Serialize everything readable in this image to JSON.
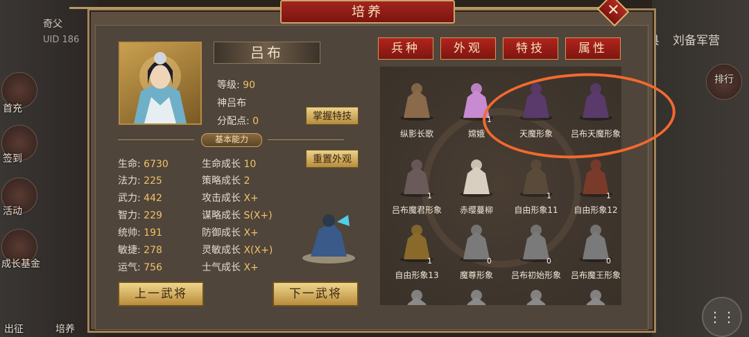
{
  "title": "培养",
  "close_icon": "close-icon",
  "background": {
    "player_name": "奇父",
    "uid": "UID 186",
    "right_tabs": [
      "县",
      "刘备军营"
    ],
    "left_side_buttons": [
      "首充",
      "签到",
      "活动",
      "成长基金"
    ],
    "bottom_left_buttons": [
      "出征",
      "培养"
    ],
    "right_side_buttons": [
      "排行"
    ],
    "bottom_right_icon": "more-icon"
  },
  "hero": {
    "name": "吕布",
    "level_label": "等级:",
    "level": "90",
    "title": "神吕布",
    "points_label": "分配点:",
    "points": "0"
  },
  "buttons": {
    "master_skill": "掌握特技",
    "reset_look": "重置外观",
    "prev": "上一武将",
    "next": "下一武将"
  },
  "section_title": "基本能力",
  "stats_left": [
    {
      "label": "生命:",
      "value": "6730"
    },
    {
      "label": "法力:",
      "value": "225"
    },
    {
      "label": "武力:",
      "value": "442"
    },
    {
      "label": "智力:",
      "value": "229"
    },
    {
      "label": "统帅:",
      "value": "191"
    },
    {
      "label": "敏捷:",
      "value": "278"
    },
    {
      "label": "运气:",
      "value": "756"
    }
  ],
  "stats_right": [
    {
      "label": "生命成长",
      "value": "10"
    },
    {
      "label": "策略成长",
      "value": "2"
    },
    {
      "label": "攻击成长",
      "value": "X+"
    },
    {
      "label": "谋略成长",
      "value": "S(X+)"
    },
    {
      "label": "防御成长",
      "value": "X+"
    },
    {
      "label": "灵敏成长",
      "value": "X(X+)"
    },
    {
      "label": "士气成长",
      "value": "X+"
    }
  ],
  "tabs": [
    "兵种",
    "外观",
    "特技",
    "属性"
  ],
  "skins": [
    {
      "label": "纵影长歌",
      "count": "",
      "color": "#8a6a4a"
    },
    {
      "label": "嫦娥",
      "count": "1",
      "color": "#c88ad0"
    },
    {
      "label": "天魔形象",
      "count": "",
      "color": "#5a3a6a"
    },
    {
      "label": "吕布天魔形象",
      "count": "",
      "color": "#5a3a6a"
    },
    {
      "label": "吕布魔君形象",
      "count": "1",
      "color": "#6a5a5a"
    },
    {
      "label": "赤缨蔓柳",
      "count": "",
      "color": "#d8cfc0"
    },
    {
      "label": "自由形象11",
      "count": "1",
      "color": "#5a4a3a"
    },
    {
      "label": "自由形象12",
      "count": "1",
      "color": "#7a3a2a"
    },
    {
      "label": "自由形象13",
      "count": "1",
      "color": "#8a6a2a"
    },
    {
      "label": "魔尊形象",
      "count": "0",
      "color": "#7a7a7a"
    },
    {
      "label": "吕布初始形象",
      "count": "0",
      "color": "#7a7a7a"
    },
    {
      "label": "吕布魔王形象",
      "count": "0",
      "color": "#7a7a7a"
    },
    {
      "label": "",
      "count": "",
      "color": "#8a8a8a"
    },
    {
      "label": "",
      "count": "",
      "color": "#8a8a8a"
    },
    {
      "label": "",
      "count": "",
      "color": "#8a8a8a"
    },
    {
      "label": "",
      "count": "",
      "color": "#8a8a8a"
    }
  ]
}
